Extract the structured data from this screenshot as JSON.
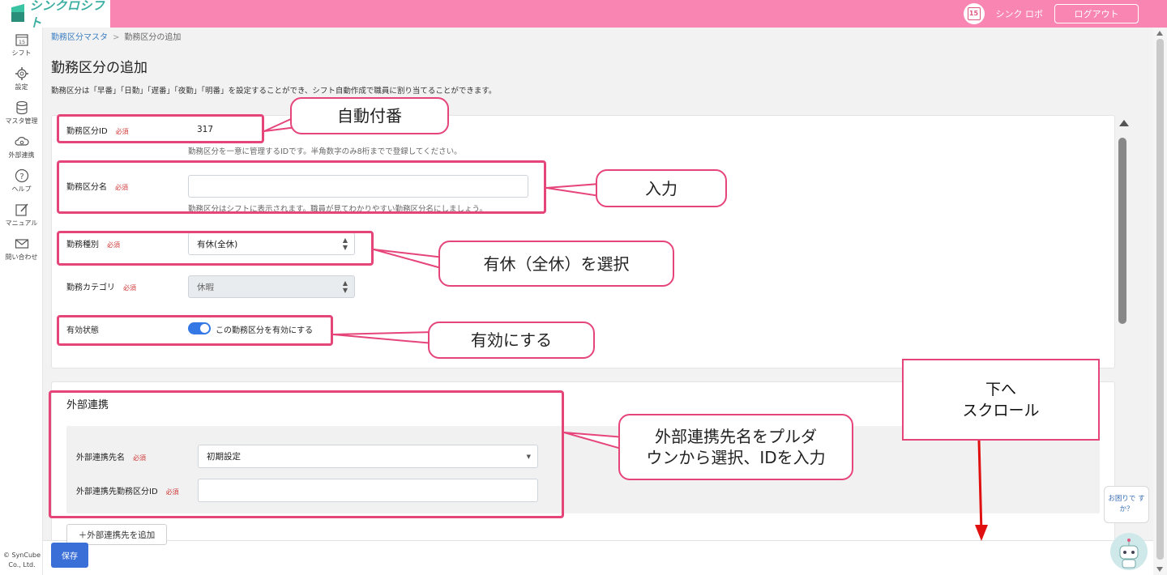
{
  "app": {
    "logo_text": "シンクロシフト"
  },
  "header": {
    "calendar_day": "15",
    "user_name": "シンク ロボ",
    "logout_label": "ログアウト"
  },
  "sidebar": {
    "items": [
      {
        "label": "シフト",
        "icon": "calendar-icon",
        "day": "15"
      },
      {
        "label": "設定",
        "icon": "gear-icon"
      },
      {
        "label": "マスタ管理",
        "icon": "database-icon"
      },
      {
        "label": "外部連携",
        "icon": "cloud-sync-icon"
      },
      {
        "label": "ヘルプ",
        "icon": "question-icon"
      },
      {
        "label": "マニュアル",
        "icon": "edit-icon"
      },
      {
        "label": "問い合わせ",
        "icon": "mail-icon"
      }
    ],
    "copyright": "© SynCube Co., Ltd."
  },
  "breadcrumb": {
    "parent": "勤務区分マスタ",
    "separator": ">",
    "current": "勤務区分の追加"
  },
  "page": {
    "title": "勤務区分の追加",
    "description": "勤務区分は「早番」「日勤」「遅番」「夜勤」「明番」を設定することができ、シフト自動作成で職員に割り当てることができます。"
  },
  "form": {
    "required_label": "必須",
    "id_label": "勤務区分ID",
    "id_value": "317",
    "id_hint": "勤務区分を一意に管理するIDです。半角数字のみ8桁までで登録してください。",
    "name_label": "勤務区分名",
    "name_value": "",
    "name_hint": "勤務区分はシフトに表示されます。職員が見てわかりやすい勤務区分名にしましょう。",
    "type_label": "勤務種別",
    "type_value": "有休(全休)",
    "category_label": "勤務カテゴリ",
    "category_value": "休暇",
    "status_label": "有効状態",
    "status_toggle_label": "この勤務区分を有効にする",
    "status_enabled": true
  },
  "external": {
    "section_title": "外部連携",
    "dest_label": "外部連携先名",
    "dest_value": "初期設定",
    "dest_id_label": "外部連携先勤務区分ID",
    "dest_id_value": "",
    "add_button": "＋外部連携先を追加"
  },
  "footer": {
    "save_label": "保存"
  },
  "help": {
    "bubble_text": "お困りで すか？"
  },
  "annotations": {
    "auto_number": "自動付番",
    "input": "入力",
    "select_paid_leave": "有休（全休）を選択",
    "enable": "有効にする",
    "external_line1": "外部連携先名をプルダ",
    "external_line2": "ウンから選択、IDを入力",
    "scroll_line1": "下へ",
    "scroll_line2": "スクロール"
  },
  "colors": {
    "header_pink": "#f986b2",
    "annotation": "#e6457a",
    "primary_blue": "#3b6fd8",
    "toggle_blue": "#3478e5",
    "scroll_arrow": "#e01010"
  }
}
